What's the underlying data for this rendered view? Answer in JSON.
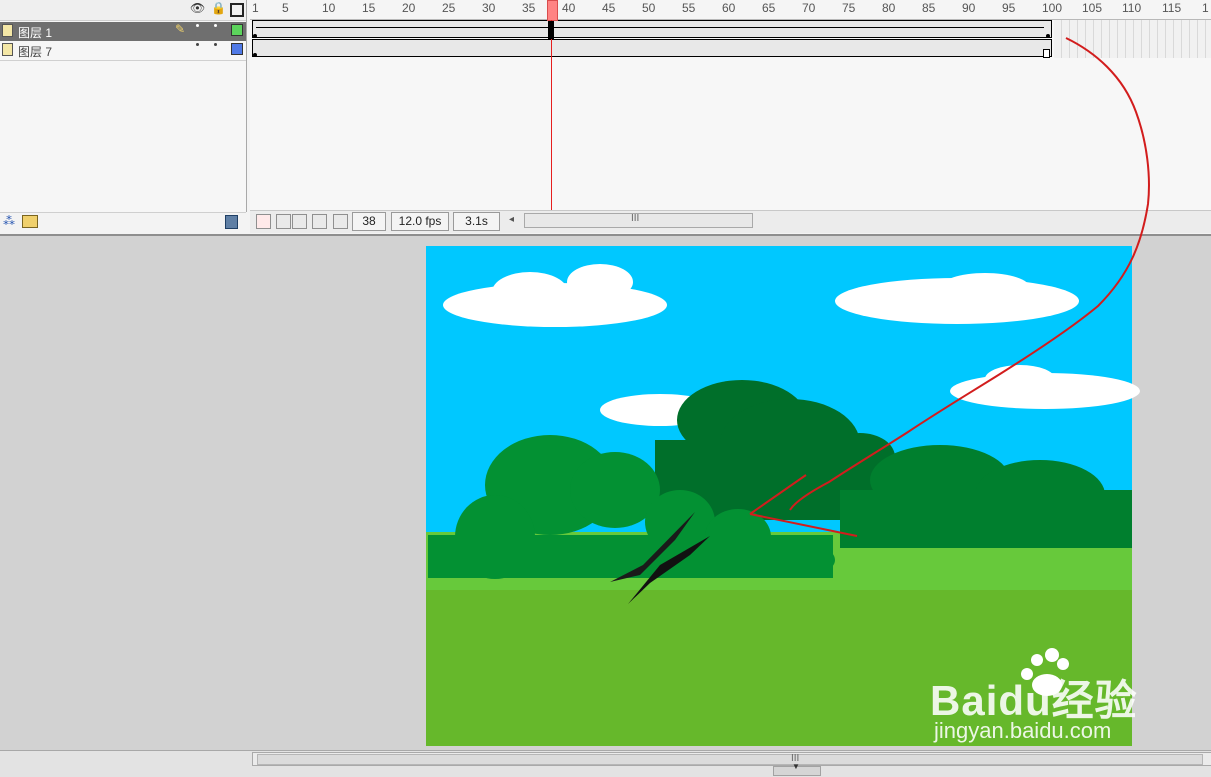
{
  "layers": {
    "rows": [
      {
        "name": "图层 1",
        "color": "#5cd35c",
        "selected": true
      },
      {
        "name": "图层 7",
        "color": "#4f79e6",
        "selected": false
      }
    ],
    "header_icons": [
      "eye-icon",
      "lock-icon",
      "outline-square-icon"
    ]
  },
  "timeline": {
    "ruler_labels": [
      "1",
      "5",
      "10",
      "15",
      "20",
      "25",
      "30",
      "35",
      "40",
      "45",
      "50",
      "55",
      "60",
      "65",
      "70",
      "75",
      "80",
      "85",
      "90",
      "95",
      "100",
      "105",
      "110",
      "115",
      "1"
    ],
    "current_frame": "38",
    "frame_rate": "12.0 fps",
    "elapsed_time": "3.1s",
    "playhead_frame": 38,
    "scroll_thumb_label": "III"
  },
  "colors": {
    "playhead": "#e61f1f",
    "sky": "#00c8ff",
    "grass": "#66b82b",
    "grass_light": "#67c93b",
    "bush_dark": "#006f2a",
    "bush_mid": "#007f2e",
    "bush_front": "#039133",
    "cloud": "#ffffff",
    "motion_path": "#d21d1d"
  },
  "watermark": {
    "brand": "Baidu经验",
    "url": "jingyan.baidu.com"
  },
  "footer": {
    "scroll_label": "III"
  }
}
